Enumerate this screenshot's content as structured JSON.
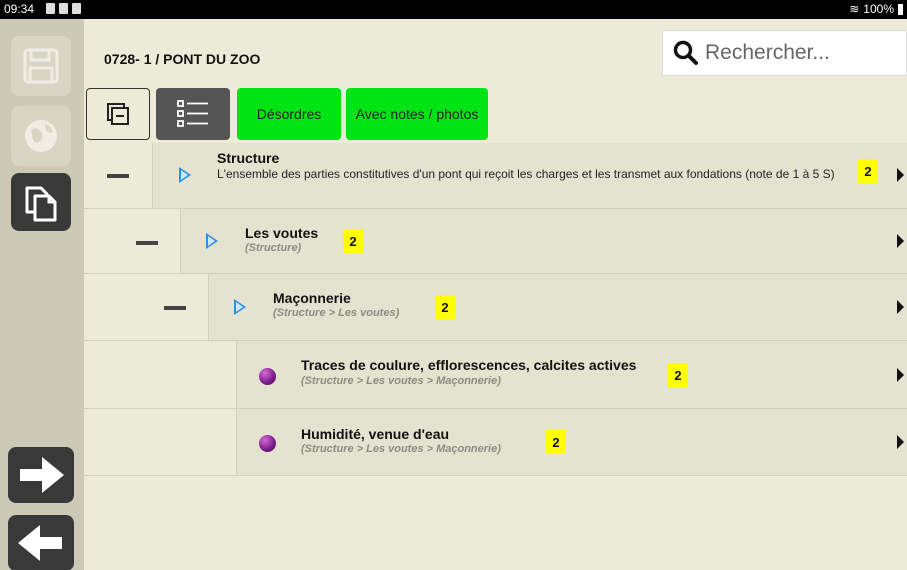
{
  "status_bar": {
    "time": "09:34",
    "battery": "100%"
  },
  "sidebar": {
    "buttons": [
      {
        "icon": "save-icon",
        "enabled": false
      },
      {
        "icon": "globe-icon",
        "enabled": false
      },
      {
        "icon": "copy-icon",
        "enabled": true
      },
      {
        "icon": "arrow-right-icon",
        "enabled": true
      },
      {
        "icon": "arrow-left-icon",
        "enabled": true
      }
    ]
  },
  "header": {
    "breadcrumb": "0728- 1 / PONT DU ZOO",
    "search_placeholder": "Rechercher..."
  },
  "toolbar": {
    "collapse_icon": "collapse-icon",
    "list_icon": "list-icon",
    "btn_desordres": "Désordres",
    "btn_notes": "Avec notes / photos"
  },
  "tree": [
    {
      "title": "Structure",
      "description": "L'ensemble des parties constitutives d'un pont qui reçoit les charges et les transmet aux fondations (note de 1 à 5 S)",
      "path": "",
      "count": "2",
      "kind": "category",
      "level": 0
    },
    {
      "title": "Les voutes",
      "description": "",
      "path": "(Structure)",
      "count": "2",
      "kind": "category",
      "level": 1
    },
    {
      "title": "Maçonnerie",
      "description": "",
      "path": "(Structure > Les voutes)",
      "count": "2",
      "kind": "category",
      "level": 2
    },
    {
      "title": "Traces de coulure, efflorescences, calcites actives",
      "description": "",
      "path": "(Structure > Les voutes > Maçonnerie)",
      "count": "2",
      "kind": "item",
      "level": 3
    },
    {
      "title": "Humidité, venue d'eau",
      "description": "",
      "path": "(Structure > Les voutes > Maçonnerie)",
      "count": "2",
      "kind": "item",
      "level": 3
    }
  ],
  "colors": {
    "accent_green": "#00e414",
    "badge_yellow": "#ffff00",
    "expand_blue": "#2f8fe0",
    "item_purple": "#7a1a86"
  }
}
